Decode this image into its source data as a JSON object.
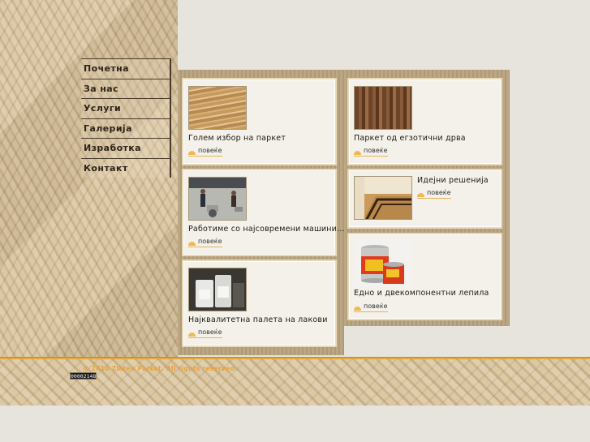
{
  "nav": {
    "items": [
      {
        "label": "Почетна"
      },
      {
        "label": "За нас"
      },
      {
        "label": "Услуги"
      },
      {
        "label": "Галерија"
      },
      {
        "label": "Изработка"
      },
      {
        "label": "Контакт"
      }
    ]
  },
  "cards": {
    "parquet": {
      "title": "Голем избор на паркет",
      "more": "повеќе",
      "icon": "planks-image"
    },
    "exotic": {
      "title": "Паркет од егзотични дрва",
      "more": "повеќе",
      "icon": "exotic-wood-image"
    },
    "machines": {
      "title": "Работиме со најсовремени машини...",
      "more": "повеќе",
      "icon": "floor-machines-image"
    },
    "ideas": {
      "title": "Идејни решенија",
      "more": "повеќе",
      "icon": "floor-design-image"
    },
    "lacquer": {
      "title": "Најквалитетна палета на лакови",
      "more": "повеќе",
      "icon": "lacquer-cans-image"
    },
    "glue": {
      "title": "Едно и двекомпонентни лепила",
      "more": "повеќе",
      "icon": "glue-buckets-image"
    }
  },
  "footer": {
    "copyright": "© 2010 Zlaten Parket. All rights reserved.",
    "counter": "00002148"
  },
  "colors": {
    "accent": "#e2a83a",
    "background": "#e6e4dc",
    "card": "#f3f1ea"
  }
}
